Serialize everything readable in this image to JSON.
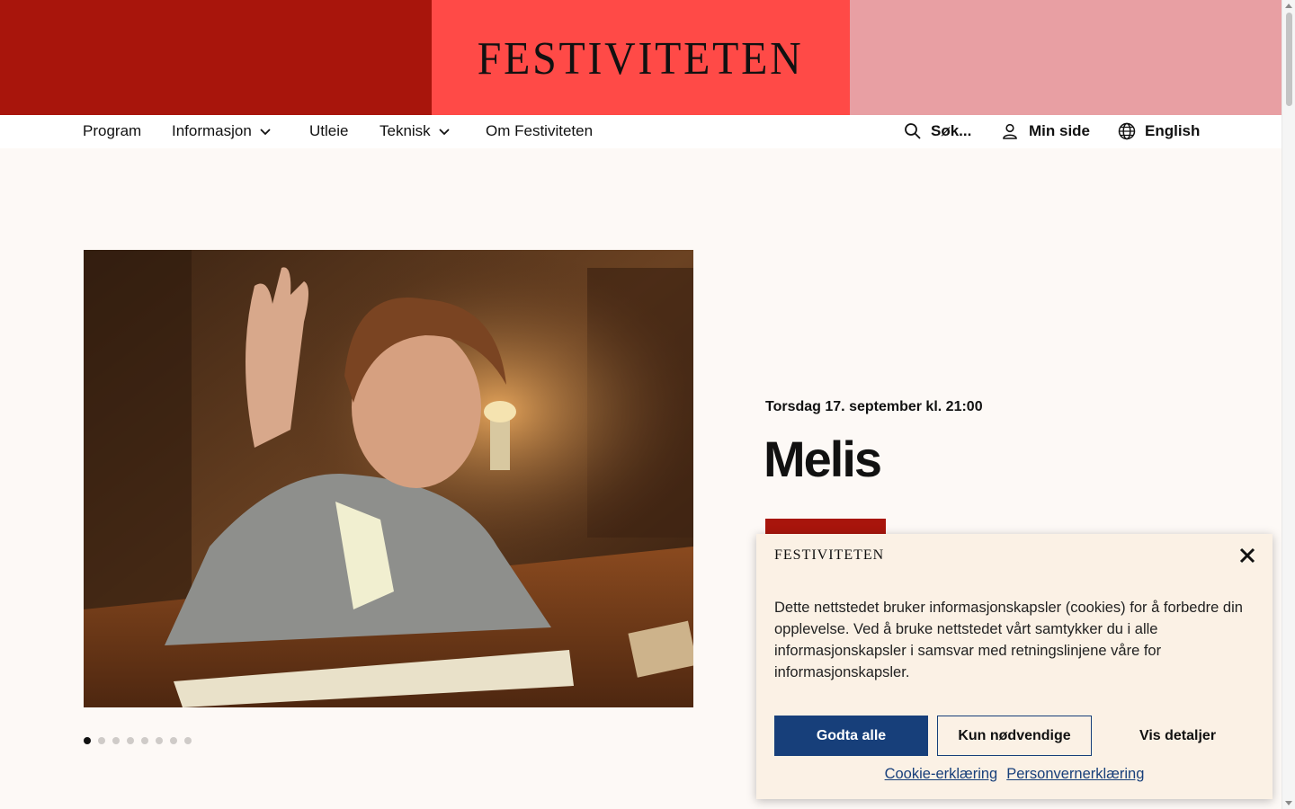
{
  "header": {
    "logo": "FESTIVITETEN",
    "band_colors": {
      "left": "#a8150c",
      "center": "#ff4a47",
      "right": "#e89fa3"
    }
  },
  "nav": {
    "items": [
      {
        "label": "Program"
      },
      {
        "label": "Informasjon"
      },
      {
        "label": "Utleie"
      },
      {
        "label": "Teknisk"
      },
      {
        "label": "Om Festiviteten"
      }
    ],
    "search_label": "Søk...",
    "account_label": "Min side",
    "language_label": "English"
  },
  "hero": {
    "image_subject": "woman-at-desk-with-keyboard",
    "dots_total": 8,
    "dots_active": 1
  },
  "event": {
    "date": "Torsdag 17. september kl. 21:00",
    "title": "Melis"
  },
  "cookie": {
    "logo": "FESTIVITETEN",
    "text": "Dette nettstedet bruker informasjonskapsler (cookies) for å forbedre din opplevelse. Ved å bruke nettstedet vårt samtykker du i alle informasjonskapsler i samsvar med retningslinjene våre for informasjonskapsler.",
    "accept_all": "Godta alle",
    "necessary_only": "Kun nødvendige",
    "show_details": "Vis detaljer",
    "cookie_policy_link": "Cookie-erklæring",
    "privacy_link": "Personvernerklæring",
    "accent_color": "#173f7a"
  }
}
